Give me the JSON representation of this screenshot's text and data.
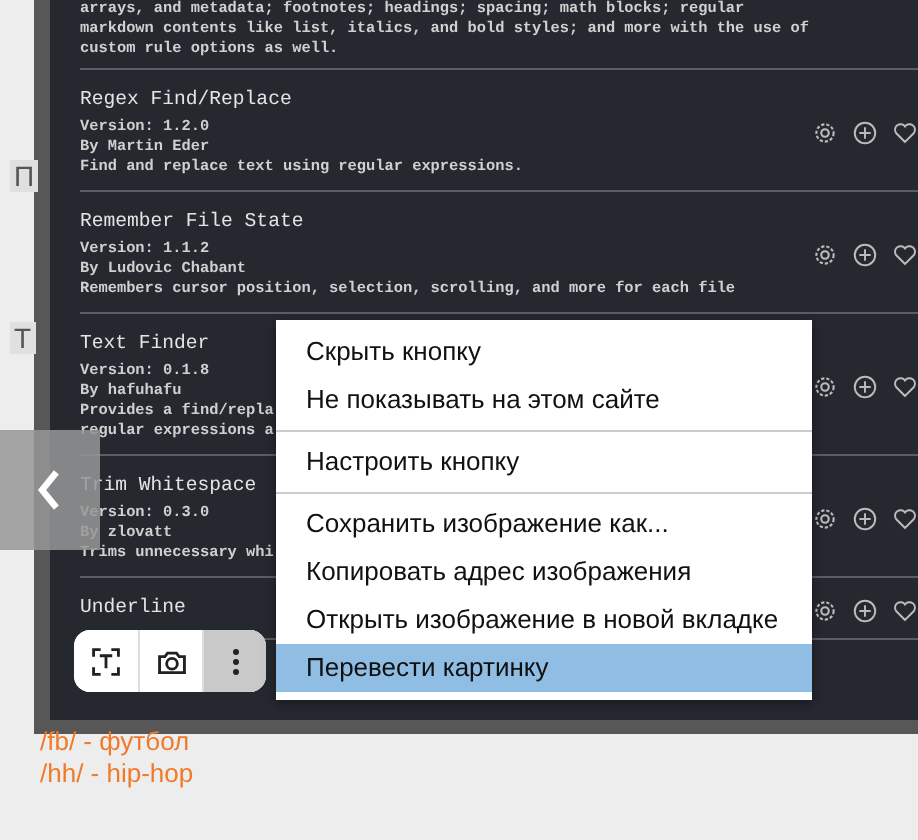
{
  "side_texts": [
    "П",
    "Т"
  ],
  "plugins": [
    {
      "kind": "partial",
      "description": [
        "arrays, and metadata; footnotes; headings; spacing; math blocks; regular",
        "markdown contents like list, italics, and bold styles; and more with the use of",
        "custom rule options as well."
      ]
    },
    {
      "kind": "full",
      "title": "Regex Find/Replace",
      "version": "Version: 1.2.0",
      "author": "By Martin Eder",
      "description": [
        "Find and replace text using regular expressions."
      ]
    },
    {
      "kind": "full",
      "title": "Remember File State",
      "version": "Version: 1.1.2",
      "author": "By Ludovic Chabant",
      "description": [
        "Remembers cursor position, selection, scrolling, and more for each file"
      ]
    },
    {
      "kind": "full",
      "title": "Text Finder",
      "version": "Version: 0.1.8",
      "author": "By hafuhafu",
      "description": [
        "Provides a find/repla",
        "regular expressions a"
      ]
    },
    {
      "kind": "full",
      "title": "Trim Whitespace",
      "version": "Version: 0.3.0",
      "author": "By zlovatt",
      "description": [
        "Trims unnecessary whi"
      ]
    },
    {
      "kind": "full",
      "title": "Underline"
    }
  ],
  "context_menu": [
    {
      "label": "Скрыть кнопку",
      "selected": false,
      "separator_after": false
    },
    {
      "label": "Не показывать на этом сайте",
      "selected": false,
      "separator_after": true
    },
    {
      "label": "Настроить кнопку",
      "selected": false,
      "separator_after": true
    },
    {
      "label": "Сохранить изображение как...",
      "selected": false,
      "separator_after": false
    },
    {
      "label": "Копировать адрес изображения",
      "selected": false,
      "separator_after": false
    },
    {
      "label": "Открыть изображение в новой вкладке",
      "selected": false,
      "separator_after": false
    },
    {
      "label": "Перевести картинку",
      "selected": true,
      "separator_after": false
    }
  ],
  "image_toolbar": [
    {
      "kind": "text-recognition",
      "selected": false
    },
    {
      "kind": "lens",
      "selected": false
    },
    {
      "kind": "more",
      "selected": true
    }
  ],
  "links": [
    "/fb/ - футбол",
    "/hh/ - hip-hop"
  ]
}
